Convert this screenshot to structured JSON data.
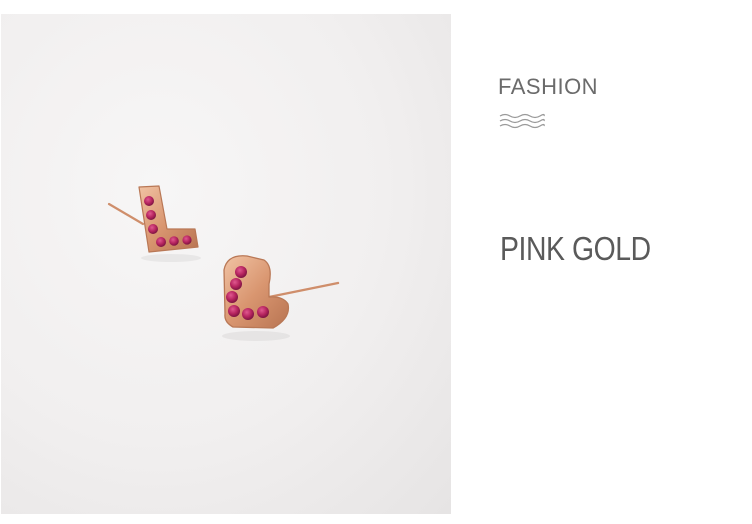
{
  "brand": {
    "label": "FASHION"
  },
  "product": {
    "color_name": "PINK GOLD"
  },
  "image": {
    "subject": "heart-shaped stud earrings with pink stones",
    "colors": {
      "metal": "#d99670",
      "stone": "#b5245e",
      "text": "#6b6b6b"
    }
  }
}
